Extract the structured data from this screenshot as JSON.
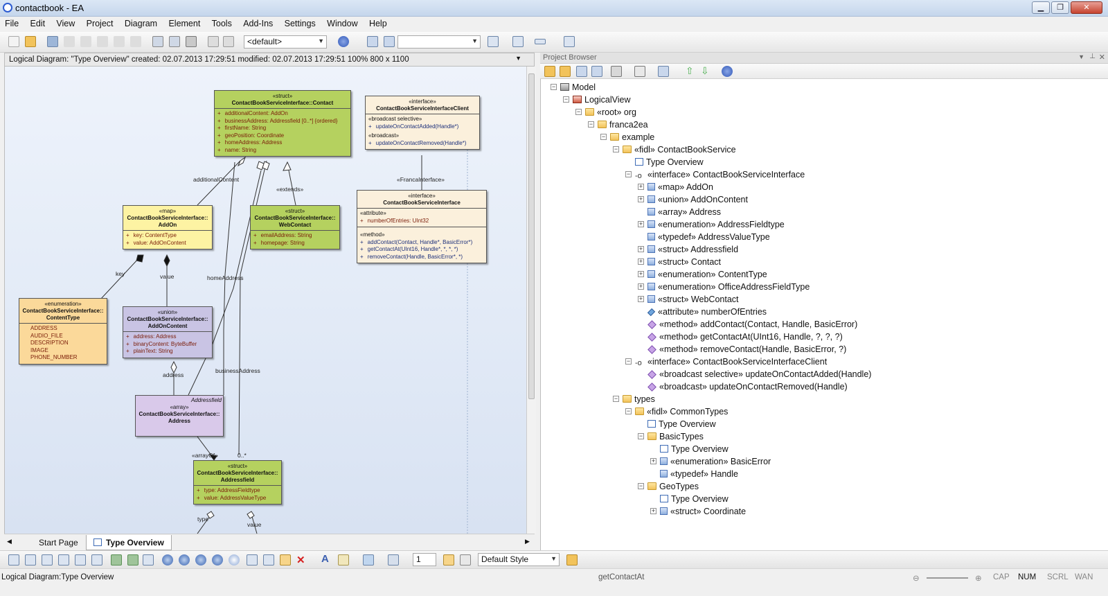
{
  "window": {
    "title": "contactbook - EA",
    "min": "▁",
    "max": "❐",
    "close": "✕"
  },
  "menus": [
    "File",
    "Edit",
    "View",
    "Project",
    "Diagram",
    "Element",
    "Tools",
    "Add-Ins",
    "Settings",
    "Window",
    "Help"
  ],
  "toolbar": {
    "perspective": "<default>",
    "empty_combo": "",
    "style_combo": "Default Style",
    "line_width": "1"
  },
  "diagram": {
    "header": "Logical Diagram: \"Type Overview\"   created: 02.07.2013 17:29:51  modified: 02.07.2013 17:29:51   100%   800 x 1100",
    "tabs": [
      "Start Page",
      "Type Overview"
    ],
    "classes": {
      "contact": {
        "stereo": "«struct»",
        "name": "ContactBookServiceInterface::Contact",
        "attrs": [
          "additionalContent:  AddOn",
          "businessAddress:  Addressfield [0..*] {ordered}",
          "firstName:  String",
          "geoPosition:  Coordinate",
          "homeAddress:  Address",
          "name:  String"
        ]
      },
      "client": {
        "stereo": "«interface»",
        "name": "ContactBookServiceInterfaceClient",
        "sec1_title": "«broadcast selective»",
        "sec1_item": "updateOnContactAdded(Handle*)",
        "sec2_title": "«broadcast»",
        "sec2_item": "updateOnContactRemoved(Handle*)"
      },
      "iface": {
        "stereo": "«interface»",
        "name": "ContactBookServiceInterface",
        "attr_title": "«attribute»",
        "attr_item": "numberOfEntries:  UInt32",
        "method_title": "«method»",
        "methods": [
          "addContact(Contact, Handle*, BasicError*)",
          "getContactAt(UInt16, Handle*, *, *, *)",
          "removeContact(Handle, BasicError*, *)"
        ]
      },
      "addon": {
        "stereo": "«map»",
        "name1": "ContactBookServiceInterface::",
        "name2": "AddOn",
        "attrs": [
          "key:  ContentType",
          "value:  AddOnContent"
        ]
      },
      "webcontact": {
        "stereo": "«struct»",
        "name1": "ContactBookServiceInterface::",
        "name2": "WebContact",
        "attrs": [
          "emailAddress:  String",
          "homepage:  String"
        ]
      },
      "contenttype": {
        "stereo": "«enumeration»",
        "name1": "ContactBookServiceInterface::",
        "name2": "ContentType",
        "items": [
          "ADDRESS",
          "AUDIO_FILE",
          "DESCRIPTION",
          "IMAGE",
          "PHONE_NUMBER"
        ]
      },
      "addoncontent": {
        "stereo": "«union»",
        "name1": "ContactBookServiceInterface::",
        "name2": "AddOnContent",
        "attrs": [
          "address:  Address",
          "binaryContent:  ByteBuffer",
          "plainText:  String"
        ]
      },
      "address": {
        "top": "Addressfield",
        "stereo": "«array»",
        "name1": "ContactBookServiceInterface::",
        "name2": "Address"
      },
      "addressfield": {
        "stereo": "«struct»",
        "name1": "ContactBookServiceInterface::",
        "name2": "Addressfield",
        "attrs": [
          "type:  AddressFieldtype",
          "value:  AddressValueType"
        ]
      }
    },
    "labels": {
      "additionalContent": "additionalContent",
      "extends": "«extends»",
      "francaInterface": "«FrancaInterface»",
      "key": "key",
      "value": "value",
      "homeAddress": "homeAddress",
      "address": "address",
      "businessAddress": "businessAddress",
      "arrayOf": "«arrayOf»",
      "mult": "0..*",
      "type": "type",
      "value2": "value"
    }
  },
  "browser": {
    "title": "Project Browser",
    "nodes": [
      {
        "t": "Model",
        "ic": "model",
        "lvl": 0,
        "exp": "-"
      },
      {
        "t": "LogicalView",
        "ic": "pkg",
        "lvl": 1,
        "exp": "-"
      },
      {
        "t": "«root» org",
        "ic": "folder",
        "lvl": 2,
        "exp": "-"
      },
      {
        "t": "franca2ea",
        "ic": "folder",
        "lvl": 3,
        "exp": "-"
      },
      {
        "t": "example",
        "ic": "folder",
        "lvl": 4,
        "exp": "-"
      },
      {
        "t": "«fidl» ContactBookService",
        "ic": "folder",
        "lvl": 5,
        "exp": "-"
      },
      {
        "t": "Type Overview",
        "ic": "diag",
        "lvl": 6,
        "exp": ""
      },
      {
        "t": "«interface» ContactBookServiceInterface",
        "ic": "iface",
        "lvl": 6,
        "exp": "-"
      },
      {
        "t": "«map» AddOn",
        "ic": "cls",
        "lvl": 7,
        "exp": "+"
      },
      {
        "t": "«union» AddOnContent",
        "ic": "cls",
        "lvl": 7,
        "exp": "+"
      },
      {
        "t": "«array» Address",
        "ic": "cls",
        "lvl": 7,
        "exp": ""
      },
      {
        "t": "«enumeration» AddressFieldtype",
        "ic": "cls",
        "lvl": 7,
        "exp": "+"
      },
      {
        "t": "«typedef» AddressValueType",
        "ic": "cls",
        "lvl": 7,
        "exp": ""
      },
      {
        "t": "«struct» Addressfield",
        "ic": "cls",
        "lvl": 7,
        "exp": "+"
      },
      {
        "t": "«struct» Contact",
        "ic": "cls",
        "lvl": 7,
        "exp": "+"
      },
      {
        "t": "«enumeration» ContentType",
        "ic": "cls",
        "lvl": 7,
        "exp": "+"
      },
      {
        "t": "«enumeration» OfficeAddressFieldType",
        "ic": "cls",
        "lvl": 7,
        "exp": "+"
      },
      {
        "t": "«struct» WebContact",
        "ic": "cls",
        "lvl": 7,
        "exp": "+"
      },
      {
        "t": "«attribute» numberOfEntries",
        "ic": "attr",
        "lvl": 7,
        "exp": ""
      },
      {
        "t": "«method» addContact(Contact, Handle, BasicError)",
        "ic": "meth",
        "lvl": 7,
        "exp": ""
      },
      {
        "t": "«method» getContactAt(UInt16, Handle, ?, ?, ?)",
        "ic": "meth",
        "lvl": 7,
        "exp": ""
      },
      {
        "t": "«method» removeContact(Handle, BasicError, ?)",
        "ic": "meth",
        "lvl": 7,
        "exp": ""
      },
      {
        "t": "«interface» ContactBookServiceInterfaceClient",
        "ic": "iface",
        "lvl": 6,
        "exp": "-"
      },
      {
        "t": "«broadcast selective» updateOnContactAdded(Handle)",
        "ic": "meth",
        "lvl": 7,
        "exp": ""
      },
      {
        "t": "«broadcast» updateOnContactRemoved(Handle)",
        "ic": "meth",
        "lvl": 7,
        "exp": ""
      },
      {
        "t": "types",
        "ic": "folder",
        "lvl": 5,
        "exp": "-"
      },
      {
        "t": "«fidl» CommonTypes",
        "ic": "folder",
        "lvl": 6,
        "exp": "-"
      },
      {
        "t": "Type Overview",
        "ic": "diag",
        "lvl": 7,
        "exp": ""
      },
      {
        "t": "BasicTypes",
        "ic": "folder",
        "lvl": 7,
        "exp": "-"
      },
      {
        "t": "Type Overview",
        "ic": "diag",
        "lvl": 8,
        "exp": ""
      },
      {
        "t": "«enumeration» BasicError",
        "ic": "cls",
        "lvl": 8,
        "exp": "+"
      },
      {
        "t": "«typedef» Handle",
        "ic": "cls",
        "lvl": 8,
        "exp": ""
      },
      {
        "t": "GeoTypes",
        "ic": "folder",
        "lvl": 7,
        "exp": "-"
      },
      {
        "t": "Type Overview",
        "ic": "diag",
        "lvl": 8,
        "exp": ""
      },
      {
        "t": "«struct» Coordinate",
        "ic": "cls",
        "lvl": 8,
        "exp": "+"
      }
    ]
  },
  "status": {
    "left": "Logical Diagram:Type Overview",
    "mid": "getContactAt",
    "cap": "CAP",
    "num": "NUM",
    "scrl": "SCRL",
    "wan": "WAN"
  }
}
